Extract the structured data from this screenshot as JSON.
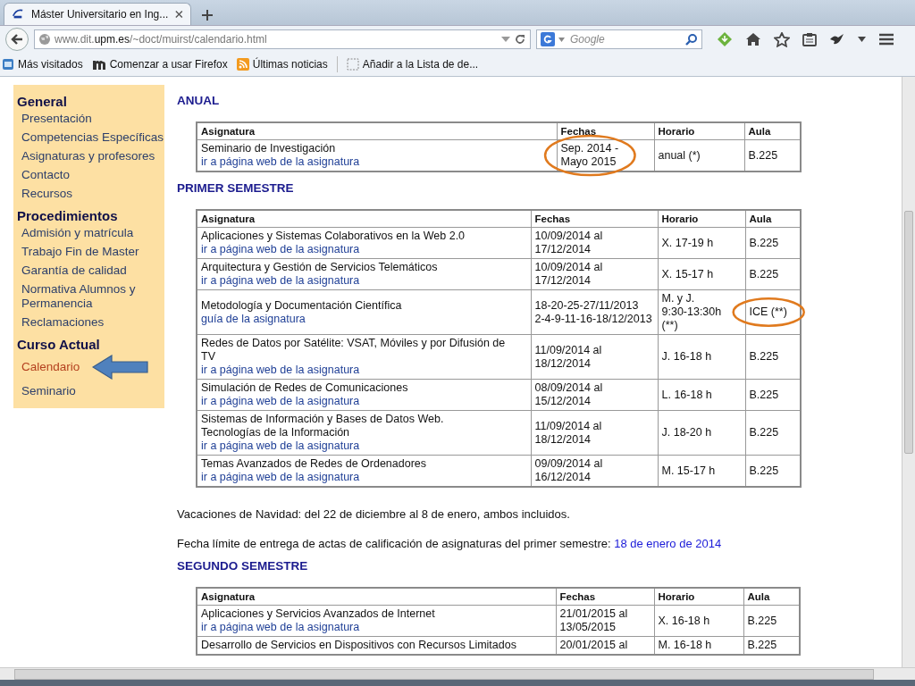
{
  "browser": {
    "tab_title": "Máster Universitario en Ing...",
    "url_host": "www.dit.",
    "url_domain": "upm.es",
    "url_path": "/~doct/muirst/calendario.html",
    "search_placeholder": "Google",
    "bookmarks": [
      {
        "kind": "visited",
        "label": "Más visitados"
      },
      {
        "kind": "m",
        "label": "Comenzar a usar Firefox"
      },
      {
        "kind": "rss",
        "label": "Últimas noticias"
      },
      {
        "kind": "list",
        "label": "Añadir a la Lista de de..."
      }
    ]
  },
  "sidebar": {
    "sections": [
      {
        "title": "General",
        "items": [
          {
            "label": "Presentación",
            "selected": false,
            "arrow": false
          },
          {
            "label": "Competencias Específicas",
            "selected": false,
            "arrow": false
          },
          {
            "label": "Asignaturas y profesores",
            "selected": false,
            "arrow": false
          },
          {
            "label": "Contacto",
            "selected": false,
            "arrow": false
          },
          {
            "label": "Recursos",
            "selected": false,
            "arrow": false
          }
        ]
      },
      {
        "title": "Procedimientos",
        "items": [
          {
            "label": "Admisión y matrícula",
            "selected": false,
            "arrow": false
          },
          {
            "label": "Trabajo Fin de Master",
            "selected": false,
            "arrow": false
          },
          {
            "label": "Garantía de calidad",
            "selected": false,
            "arrow": false
          },
          {
            "label": "Normativa Alumnos y Permanencia",
            "selected": false,
            "arrow": false
          },
          {
            "label": "Reclamaciones",
            "selected": false,
            "arrow": false
          }
        ]
      },
      {
        "title": "Curso Actual",
        "items": [
          {
            "label": "Calendario",
            "selected": true,
            "arrow": true
          },
          {
            "label": "Seminario",
            "selected": false,
            "arrow": false
          }
        ]
      }
    ]
  },
  "blocks": [
    {
      "kind": "section",
      "title": "ANUAL",
      "columns": [
        "Asignatura",
        "Fechas",
        "Horario",
        "Aula"
      ],
      "rows": [
        {
          "subject": "Seminario de Investigación",
          "link": "ir a página web de la asignatura",
          "dates": "Sep. 2014 -\nMayo 2015",
          "dates_circled": true,
          "schedule": "anual (*)",
          "room": "B.225",
          "room_circled": false
        }
      ]
    },
    {
      "kind": "section",
      "title": "PRIMER SEMESTRE",
      "columns": [
        "Asignatura",
        "Fechas",
        "Horario",
        "Aula"
      ],
      "rows": [
        {
          "subject": "Aplicaciones y Sistemas Colaborativos en la Web 2.0",
          "link": "ir a página web de la asignatura",
          "dates": "10/09/2014 al\n17/12/2014",
          "dates_circled": false,
          "schedule": "X. 17-19 h",
          "room": "B.225",
          "room_circled": false
        },
        {
          "subject": "Arquitectura y Gestión de Servicios Telemáticos",
          "link": "ir a página web de la asignatura",
          "dates": "10/09/2014 al\n17/12/2014",
          "dates_circled": false,
          "schedule": "X. 15-17 h",
          "room": "B.225",
          "room_circled": false
        },
        {
          "subject": "Metodología y Documentación Científica",
          "link": "guía de la asignatura",
          "dates": "18-20-25-27/11/2013\n2-4-9-11-16-18/12/2013",
          "dates_circled": false,
          "schedule": "M. y J.\n9:30-13:30h\n(**)",
          "room": "ICE (**)",
          "room_circled": true
        },
        {
          "subject": "Redes de Datos por Satélite: VSAT, Móviles y por Difusión de\nTV",
          "link": "ir a página web de la asignatura",
          "dates": "11/09/2014 al\n18/12/2014",
          "dates_circled": false,
          "schedule": "J. 16-18 h",
          "room": "B.225",
          "room_circled": false
        },
        {
          "subject": "Simulación de Redes de Comunicaciones",
          "link": "ir a página web de la asignatura",
          "dates": "08/09/2014 al\n15/12/2014",
          "dates_circled": false,
          "schedule": "L. 16-18 h",
          "room": "B.225",
          "room_circled": false
        },
        {
          "subject": "Sistemas de Información y Bases de Datos Web.\nTecnologías de la Información",
          "link": "ir a página web de la asignatura",
          "dates": "11/09/2014 al\n18/12/2014",
          "dates_circled": false,
          "schedule": "J. 18-20 h",
          "room": "B.225",
          "room_circled": false
        },
        {
          "subject": "Temas Avanzados de Redes de Ordenadores",
          "link": "ir a página web de la asignatura",
          "dates": "09/09/2014 al\n16/12/2014",
          "dates_circled": false,
          "schedule": "M. 15-17 h",
          "room": "B.225",
          "room_circled": false
        }
      ]
    },
    {
      "kind": "note",
      "text": "Vacaciones de Navidad: del 22 de diciembre al 8 de enero, ambos incluidos."
    },
    {
      "kind": "note",
      "text": "Fecha límite de entrega de actas de calificación de asignaturas del primer semestre: ",
      "link": "18 de enero de 2014"
    },
    {
      "kind": "section",
      "title": "SEGUNDO SEMESTRE",
      "columns": [
        "Asignatura",
        "Fechas",
        "Horario",
        "Aula"
      ],
      "rows": [
        {
          "subject": "Aplicaciones y Servicios Avanzados de Internet",
          "link": "ir a página web de la asignatura",
          "dates": "21/01/2015 al\n13/05/2015",
          "dates_circled": false,
          "schedule": "X. 16-18 h",
          "room": "B.225",
          "room_circled": false
        },
        {
          "subject": "Desarrollo de Servicios en Dispositivos con Recursos Limitados",
          "dates": "20/01/2015 al",
          "dates_circled": false,
          "schedule": "M. 16-18 h",
          "room": "B.225",
          "room_circled": false
        }
      ]
    }
  ]
}
